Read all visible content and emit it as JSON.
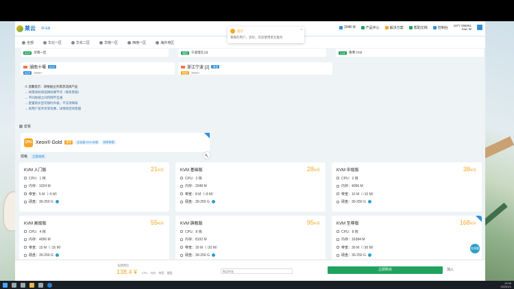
{
  "brand": {
    "name": "莱云",
    "lang": "中 EN"
  },
  "nav": [
    {
      "label": "2048 M",
      "icon": "search-icon",
      "color": "#2f8fd8"
    },
    {
      "label": "产品中心",
      "icon": "grid-icon",
      "color": "#21a25f"
    },
    {
      "label": "解决方案",
      "icon": "box-icon",
      "color": "#f5a623"
    },
    {
      "label": "帮助文档",
      "icon": "doc-icon",
      "color": "#21a25f"
    },
    {
      "label": "控制台",
      "icon": "console-icon",
      "color": "#2f8fd8"
    }
  ],
  "user": {
    "line1": "1877 096061",
    "line2": "Kwc W"
  },
  "subnav": [
    "全部",
    "华北一区",
    "华东二区",
    "华南一区",
    "西南一区",
    "海外地区"
  ],
  "band": [
    {
      "text": "华南一区",
      "tag": "BGP"
    },
    {
      "text": "宁波电信 [2]",
      "tag": "电信"
    },
    {
      "text": "香港 CN2",
      "tag": "CN2"
    }
  ],
  "regions": [
    {
      "name": "湖南十堰",
      "tag": "BGP",
      "sub": "3000+"
    },
    {
      "name": "浙江宁波 [2]",
      "tag": "电信",
      "sub": "3000+"
    }
  ],
  "notice": {
    "head": "① 温馨提示：请根据业务需求选择产品",
    "lines": [
      "→ 如需高防请选择防御节点（联系客服）",
      "→ 不同地域之间内网不互通",
      "→ 配置购买后可随时升级，不支持降级",
      "→ 新用户首单享受优惠，详情请咨询客服"
    ]
  },
  "section_label": "套餐",
  "gold": {
    "name": "Xeon® Gold",
    "tags": [
      "推荐",
      "企业级 SSD 存储",
      "独享带宽"
    ],
    "icon_text": "CPU"
  },
  "filter": {
    "label": "规格",
    "tag": "全部规格"
  },
  "products": [
    {
      "name": "KVM 入门版",
      "price": "21",
      "unit": "¥/月",
      "specs": [
        "CPU：1 核",
        "内存：1024 M",
        "带宽：5 M（↑5 M）",
        "硬盘：30-250 G"
      ]
    },
    {
      "name": "KVM 基础版",
      "price": "28",
      "unit": "¥/月",
      "specs": [
        "CPU：2 核",
        "内存：2048 M",
        "带宽：8 M（↑8 M）",
        "硬盘：30-250 G"
      ]
    },
    {
      "name": "KVM 中级版",
      "price": "38",
      "unit": "¥/月",
      "specs": [
        "CPU：2 核",
        "内存：4096 M",
        "带宽：10 M（↑10 M）",
        "硬盘：30-250 G"
      ]
    },
    {
      "name": "KVM 高级版",
      "price": "55",
      "unit": "¥/月",
      "specs": [
        "CPU：4 核",
        "内存：4096 M",
        "带宽：15 M（↑15 M）",
        "硬盘：30-250 G"
      ]
    },
    {
      "name": "KVM 旗舰版",
      "price": "95",
      "unit": "¥/月",
      "specs": [
        "CPU：8 核",
        "内存：8192 M",
        "带宽：20 M（↑20 M）",
        "硬盘：30-250 G"
      ]
    },
    {
      "name": "KVM 至尊版",
      "price": "168",
      "unit": "¥/月",
      "specs": [
        "CPU：8 核",
        "内存：16384 M",
        "带宽：30 M（↑30 M）",
        "硬盘：30-250 G"
      ]
    }
  ],
  "toast": {
    "title": "提示",
    "body": "尊敬的用户，您好，欢迎使用莱云服务"
  },
  "order": {
    "label": "配置费用",
    "price": "138.4 ¥",
    "details": [
      "CPU",
      "内存",
      "带宽",
      "硬盘"
    ],
    "select": "购买时长",
    "buy": "立即购买",
    "cart": "加入"
  },
  "chat_label": "在线客服",
  "taskbar": {
    "time": "12:00",
    "date": "2023/1/1"
  }
}
